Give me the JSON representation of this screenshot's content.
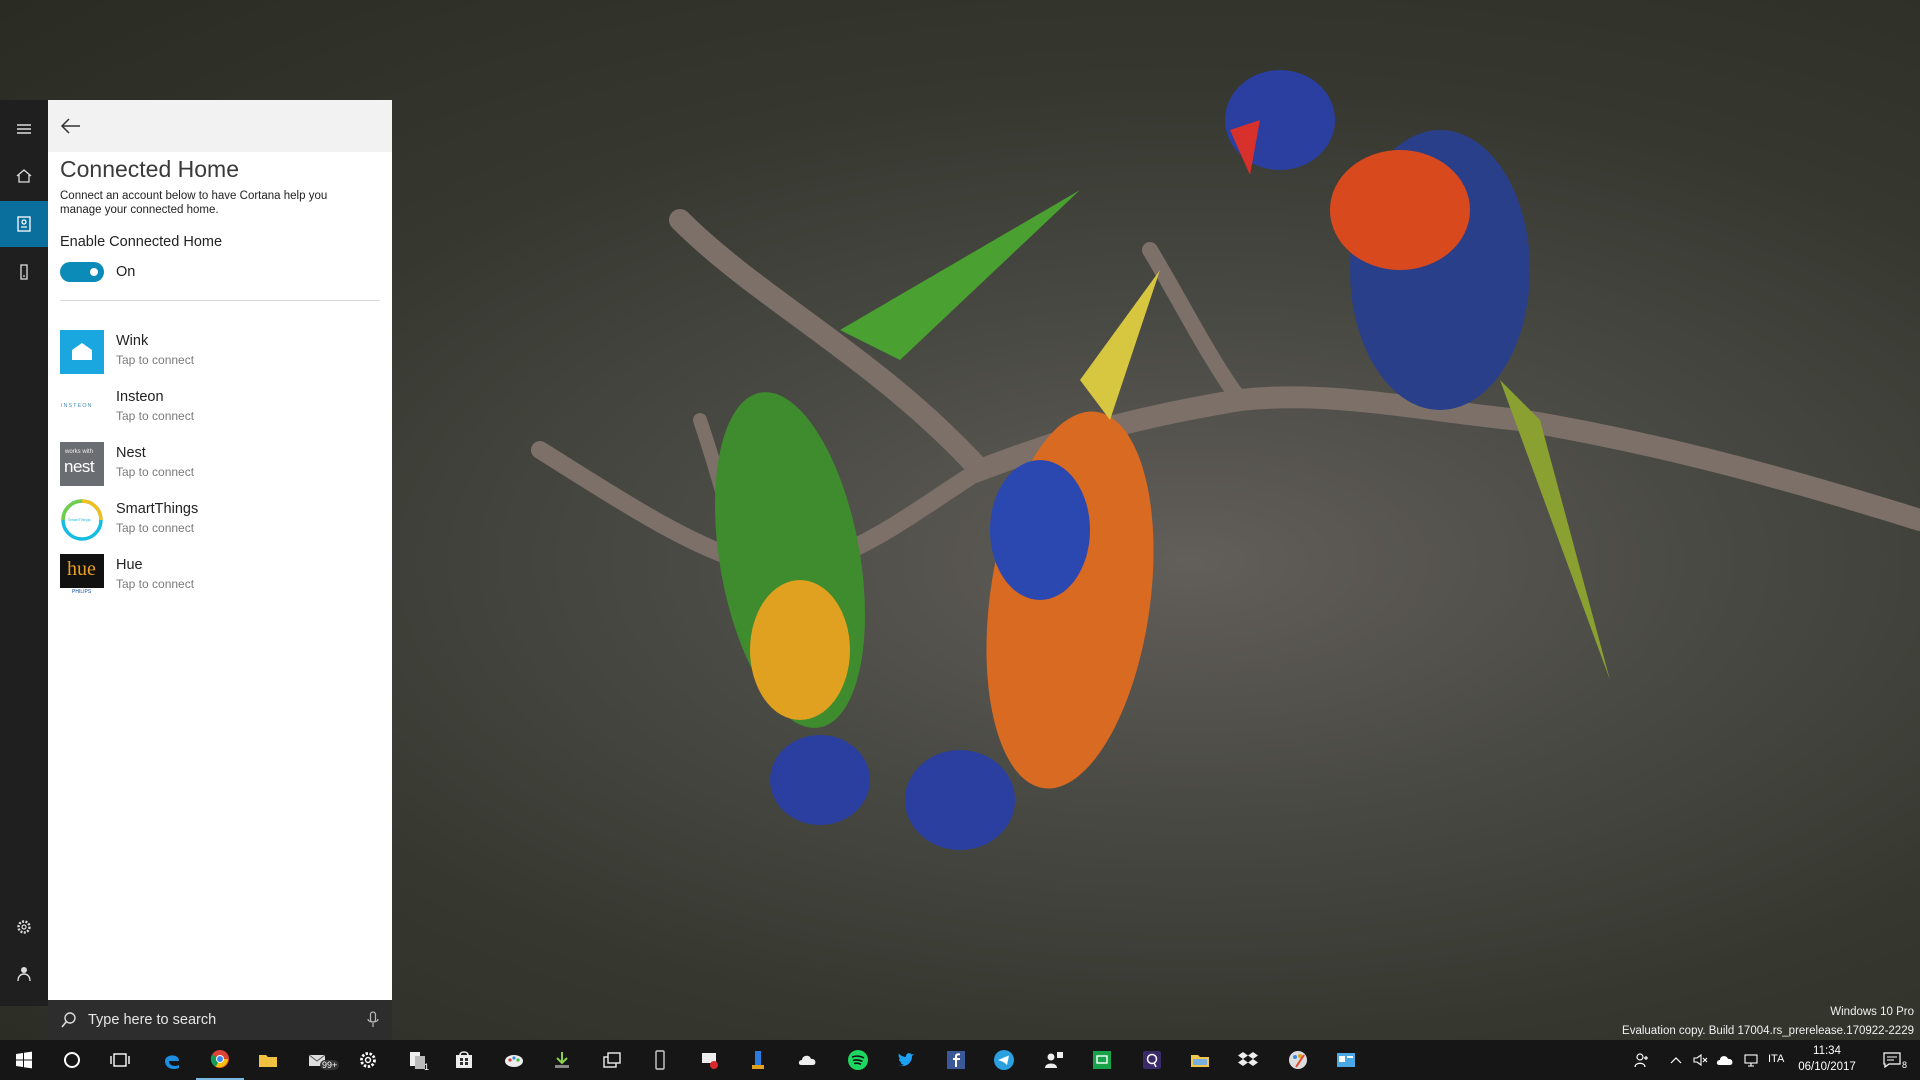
{
  "panel": {
    "title": "Connected Home",
    "description": "Connect an account below to have Cortana help you manage your connected home.",
    "enable_label": "Enable Connected Home",
    "toggle_state": "On",
    "services": [
      {
        "name": "Wink",
        "status": "Tap to connect",
        "logo_text": ""
      },
      {
        "name": "Insteon",
        "status": "Tap to connect",
        "logo_text": "INSTEON"
      },
      {
        "name": "Nest",
        "status": "Tap to connect",
        "logo_text": "nest",
        "logo_sub": "works with"
      },
      {
        "name": "SmartThings",
        "status": "Tap to connect",
        "logo_text": "SmartThings"
      },
      {
        "name": "Hue",
        "status": "Tap to connect",
        "logo_text": "hue",
        "logo_sub": "PHILIPS"
      }
    ]
  },
  "rail": {
    "items": [
      "menu-icon",
      "home-icon",
      "notebook-icon",
      "devices-icon",
      "settings-icon",
      "feedback-icon"
    ]
  },
  "search": {
    "placeholder": "Type here to search"
  },
  "watermark": {
    "edition": "Windows 10 Pro",
    "build": "Evaluation copy. Build 17004.rs_prerelease.170922-2229"
  },
  "taskbar": {
    "mail_badge": "99+",
    "store_badge": "1",
    "language": "ITA",
    "time": "11:34",
    "date": "06/10/2017",
    "notifications": "8"
  },
  "colors": {
    "accent": "#0a8bb8",
    "rail_active": "#0a6f9c",
    "rail_bg": "#1f1f1f",
    "taskbar_bg": "#161616"
  }
}
